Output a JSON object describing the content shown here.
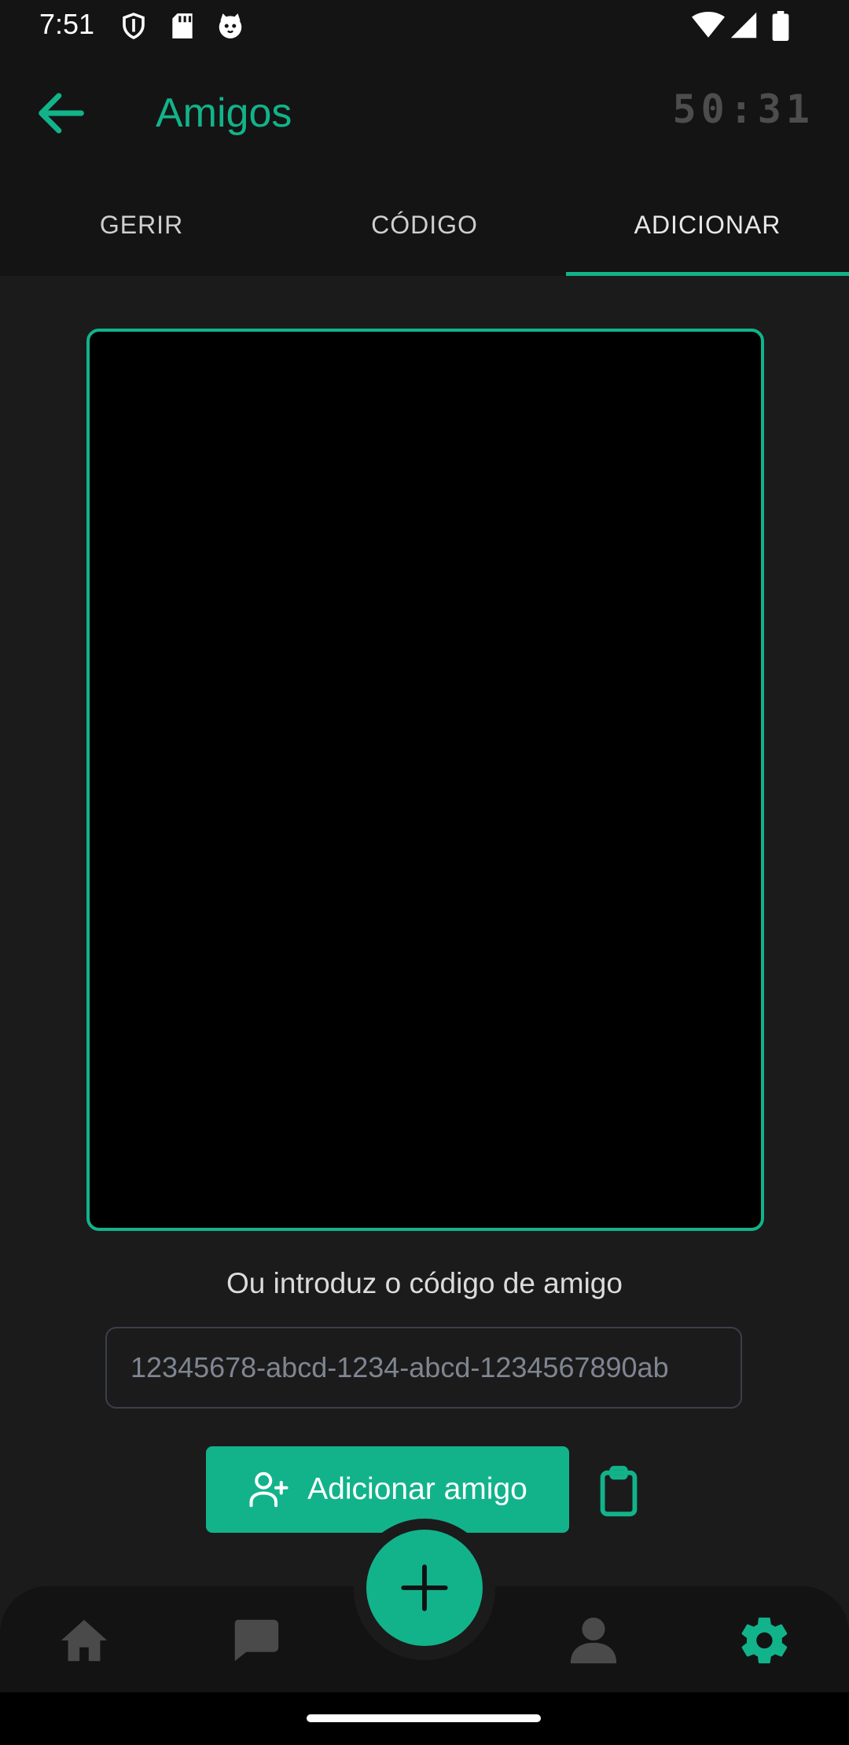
{
  "status_bar": {
    "time": "7:51",
    "icons": [
      "shield-icon",
      "sd-card-icon",
      "cat-icon",
      "wifi-icon",
      "signal-icon",
      "battery-icon"
    ]
  },
  "app_bar": {
    "title": "Amigos",
    "timer": "50:31",
    "accent_color": "#12b38a"
  },
  "tabs": [
    {
      "label": "GERIR",
      "active": false
    },
    {
      "label": "CÓDIGO",
      "active": false
    },
    {
      "label": "ADICIONAR",
      "active": true
    }
  ],
  "add_friend": {
    "prompt": "Ou introduz o código de amigo",
    "code_placeholder": "12345678-abcd-1234-abcd-1234567890ab",
    "button_label": "Adicionar amigo"
  },
  "bottom_nav": {
    "items": [
      "home-icon",
      "chat-icon",
      "add-icon",
      "profile-icon",
      "settings-icon"
    ],
    "active": "settings-icon"
  }
}
